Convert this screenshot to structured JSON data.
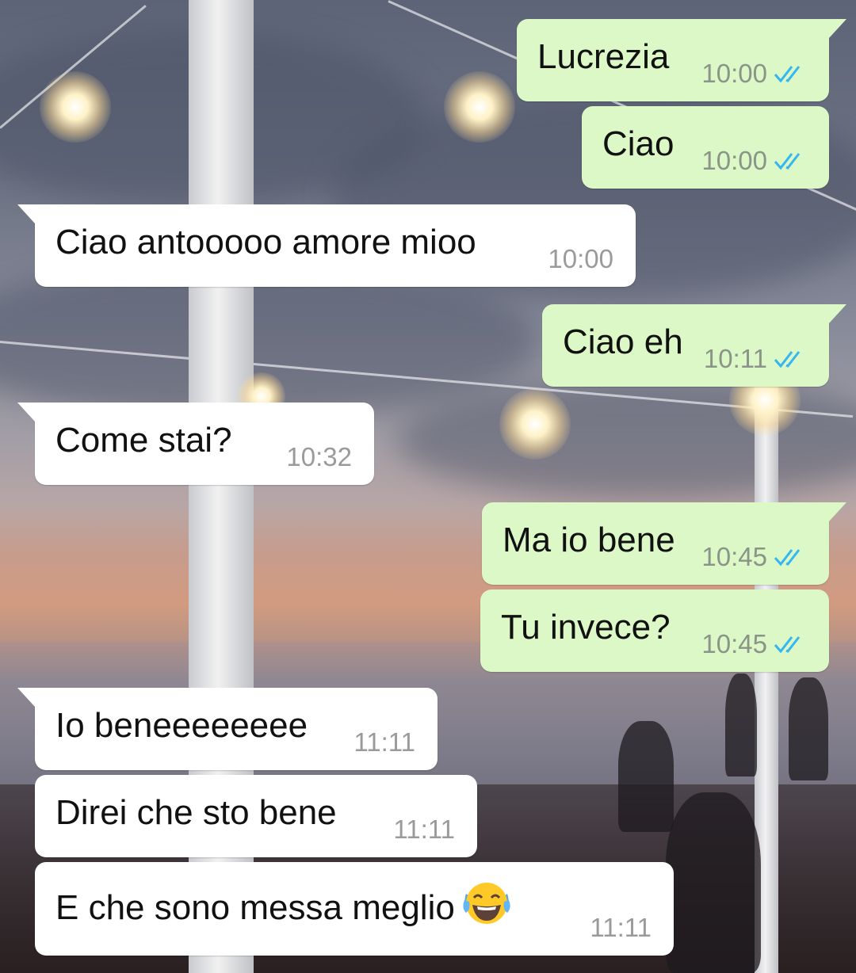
{
  "colors": {
    "outgoing_bubble": "#dcf8c6",
    "incoming_bubble": "#ffffff",
    "read_ticks": "#34b7f1",
    "timestamp": "#8a9488"
  },
  "messages": [
    {
      "direction": "outgoing",
      "text": "Lucrezia",
      "time": "10:00",
      "status_icon": "double-check-icon"
    },
    {
      "direction": "outgoing",
      "text": "Ciao",
      "time": "10:00",
      "status_icon": "double-check-icon"
    },
    {
      "direction": "incoming",
      "text": "Ciao antooooo amore mioo",
      "time": "10:00"
    },
    {
      "direction": "outgoing",
      "text": "Ciao eh",
      "time": "10:11",
      "status_icon": "double-check-icon"
    },
    {
      "direction": "incoming",
      "text": "Come stai?",
      "time": "10:32"
    },
    {
      "direction": "outgoing",
      "text": "Ma io bene",
      "time": "10:45",
      "status_icon": "double-check-icon"
    },
    {
      "direction": "outgoing",
      "text": "Tu invece?",
      "time": "10:45",
      "status_icon": "double-check-icon"
    },
    {
      "direction": "incoming",
      "text": "Io beneeeeeeee",
      "time": "11:11"
    },
    {
      "direction": "incoming",
      "text": "Direi che sto bene",
      "time": "11:11"
    },
    {
      "direction": "incoming",
      "text": "E che sono messa meglio",
      "time": "11:11",
      "emoji": "tears-of-joy-emoji-icon"
    }
  ]
}
